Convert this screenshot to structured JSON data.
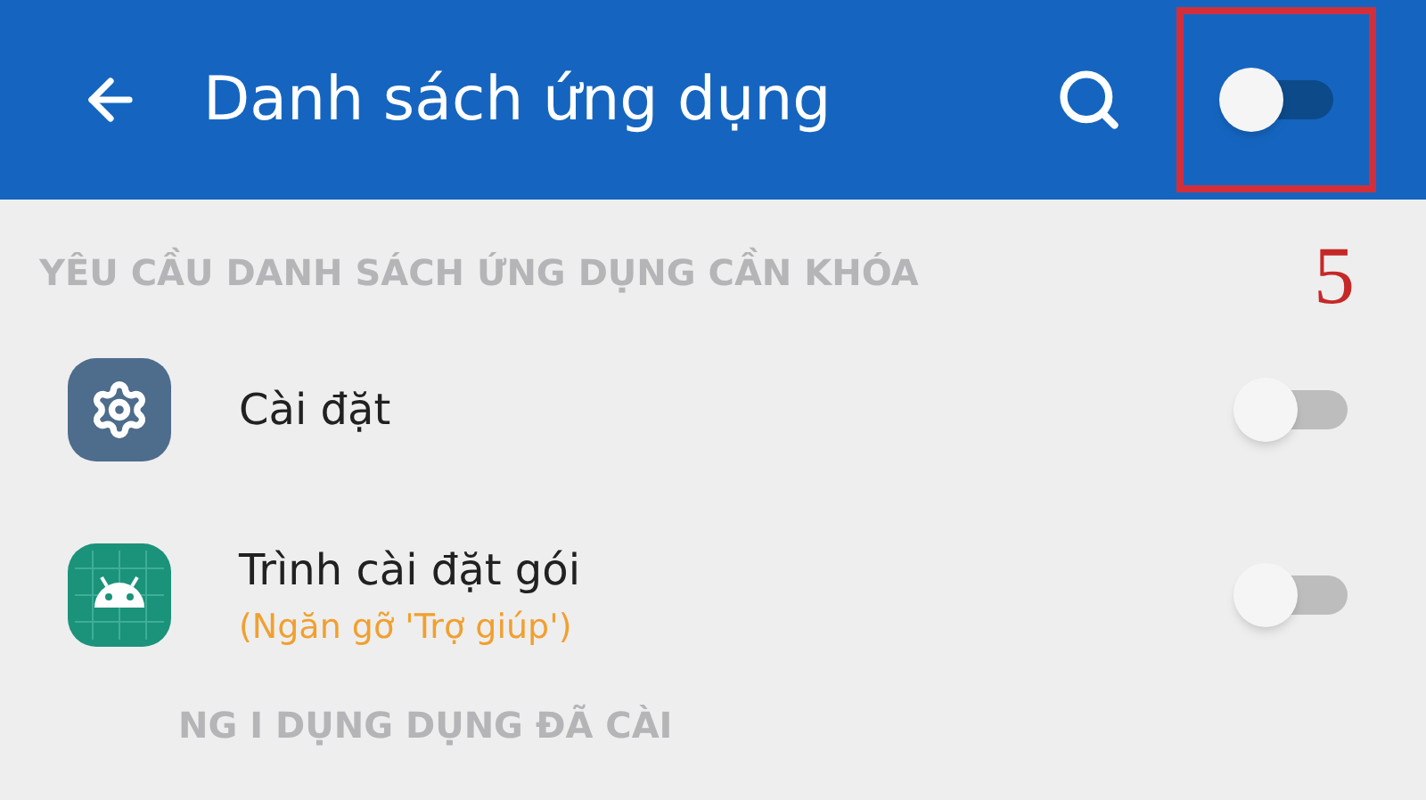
{
  "header": {
    "title": "Danh sách ứng dụng",
    "toggle": {
      "on": false
    }
  },
  "annotation": {
    "label": "5"
  },
  "section_title": "YÊU CẦU DANH SÁCH ỨNG DỤNG CẦN KHÓA",
  "apps": [
    {
      "kind": "settings",
      "name": "Cài đặt",
      "on": false
    },
    {
      "kind": "installer",
      "name": "Trình cài đặt gói",
      "note": "(Ngăn gỡ 'Trợ giúp')",
      "on": false
    }
  ],
  "section_2_title": "NG I DỤNG DỤNG ĐÃ CÀI"
}
